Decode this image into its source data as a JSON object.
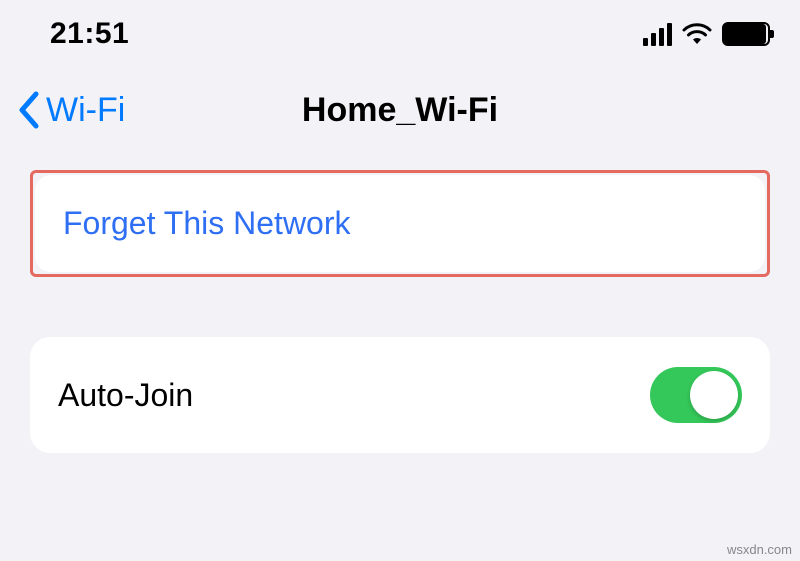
{
  "status": {
    "time": "21:51"
  },
  "nav": {
    "back_label": "Wi-Fi",
    "title": "Home_Wi-Fi"
  },
  "actions": {
    "forget_label": "Forget This Network"
  },
  "settings": {
    "auto_join_label": "Auto-Join",
    "auto_join_on": true
  },
  "colors": {
    "accent": "#007aff",
    "toggle_on": "#34c759",
    "highlight": "#e46a60"
  },
  "watermark": "wsxdn.com"
}
